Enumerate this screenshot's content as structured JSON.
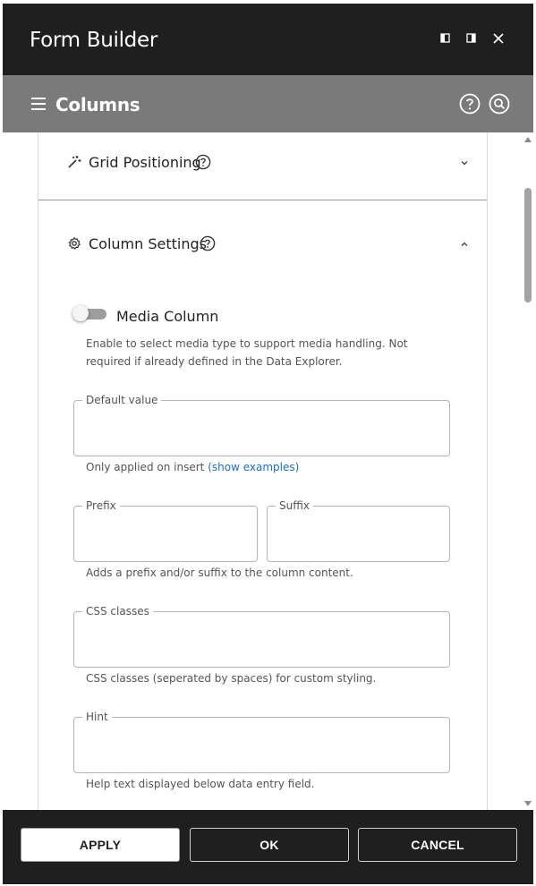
{
  "window": {
    "title": "Form Builder"
  },
  "header": {
    "section_title": "Columns"
  },
  "accordions": {
    "grid_positioning": {
      "label": "Grid Positioning",
      "expanded": false
    },
    "column_settings": {
      "label": "Column Settings",
      "expanded": true
    }
  },
  "media_column": {
    "label": "Media Column",
    "enabled": false,
    "help": "Enable to select media type to support media handling. Not required if already defined in the Data Explorer."
  },
  "fields": {
    "default_value": {
      "legend": "Default value",
      "value": "",
      "help": "Only applied on insert",
      "help_link": "(show examples)"
    },
    "prefix": {
      "legend": "Prefix",
      "value": ""
    },
    "suffix": {
      "legend": "Suffix",
      "value": ""
    },
    "prefix_suffix_help": "Adds a prefix and/or suffix to the column content.",
    "css_classes": {
      "legend": "CSS classes",
      "value": "",
      "help": "CSS classes (seperated by spaces) for custom styling."
    },
    "hint": {
      "legend": "Hint",
      "value": "",
      "help": "Help text displayed below data entry field."
    }
  },
  "footer": {
    "apply_label": "APPLY",
    "ok_label": "OK",
    "cancel_label": "CANCEL"
  },
  "colors": {
    "titlebar_bg": "#1f1f1f",
    "section_header_bg": "#7a7a7a",
    "link": "#1a6fc4"
  }
}
